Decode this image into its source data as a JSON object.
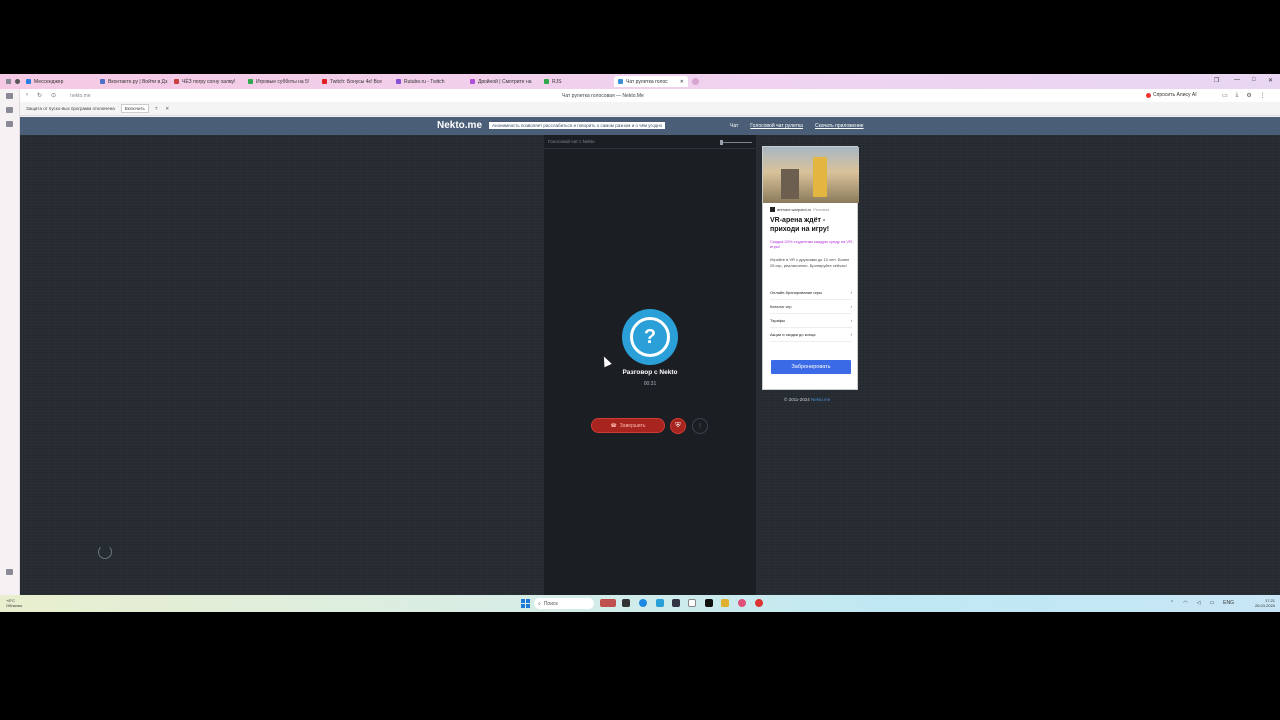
{
  "browser": {
    "tabs": [
      {
        "label": "Мессенджер",
        "color": "#2a7ee6"
      },
      {
        "label": "Вконтакте.ру | Войти в Дз",
        "color": "#4b72c7"
      },
      {
        "label": "ЧЁЗ погру согну халву!",
        "color": "#c84040"
      },
      {
        "label": "Игровые субботы на 5!",
        "color": "#2fa84f"
      },
      {
        "label": "Twitch: Бонусы 4к! Все",
        "color": "#e02020"
      },
      {
        "label": "Rutube.ru - Twitch",
        "color": "#8a4fd8"
      },
      {
        "label": "Двойной | Смотрите на",
        "color": "#b14fd8"
      },
      {
        "label": "RJS",
        "color": "#2ea84a"
      },
      {
        "label": "Чат рулетка голос",
        "color": "#3a8fd8",
        "active": true
      }
    ],
    "url": "nekto.me",
    "page_title": "Чат рулетка голосовая — Nekto.Me",
    "ask_alice": "Спросить Алису AI",
    "notification": "Защита от пуско-вых программ отключена",
    "notification_button": "Включить"
  },
  "site": {
    "logo": "Nekto.me",
    "promo": "Анонимность позволяет расслабиться и говорить о самом разном и о чём угодно",
    "nav": [
      "Чат",
      "Голосовой чат рулетка",
      "Скачать приложение"
    ]
  },
  "chat": {
    "breadcrumb": "Голосовой чат с Nekto",
    "avatar_glyph": "?",
    "partner_name": "Разговор с Nekto",
    "timer": "00:31",
    "end_button": "Завершить",
    "end_icon": "phone-hangup-icon",
    "shield_icon": "shield-icon",
    "info_icon": "info-icon"
  },
  "ad": {
    "source": "arenavr.warpoint.ru",
    "source_tag": "Реклама",
    "title": "VR-арена ждёт - приходи на игру!",
    "promo": "Скидка 20% студентам каждую среду на VR-игры!",
    "description": "Играйте в VR с друзьями до 10 чел. Более 25 игр, реалистично. Бронируйте сейчас!",
    "links": [
      "Онлайн-бронирование игры",
      "Каталог игр",
      "Тарифы",
      "Акции и скидки до конца"
    ],
    "cta": "Забронировать"
  },
  "footer": {
    "copyright": "© 2011-2024",
    "copyright_link": "Nekto.me"
  },
  "taskbar": {
    "weather_temp": "+8°C",
    "weather_text": "Облачно",
    "search_placeholder": "Поиск",
    "tray_lang": "ENG",
    "clock_time": "17:21",
    "clock_date": "26.03.2024"
  }
}
